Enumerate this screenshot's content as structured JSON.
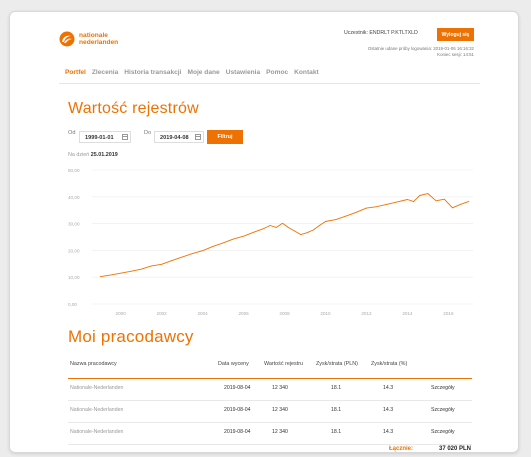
{
  "header": {
    "logo_line1": "nationale",
    "logo_line2": "nederlanden",
    "user_label": "Uczestnik: ENDRLT P.KTLTXLD",
    "logout_label": "Wyloguj się",
    "last_login": "Ostatnie udane próby logowania: 2019-01-06 16:16:32",
    "session": "Koniec sesji: 14:51"
  },
  "nav": {
    "items": [
      "Portfel",
      "Zlecenia",
      "Historia transakcji",
      "Moje dane",
      "Ustawienia",
      "Pomoc",
      "Kontakt"
    ],
    "active": "Portfel"
  },
  "registry": {
    "title": "Wartość rejestrów",
    "from_label": "Od",
    "from_value": "1999-01-01",
    "to_label": "Do",
    "to_value": "2019-04-08",
    "filter_label": "Filtruj",
    "asof_label": "Na dzień",
    "asof_value": "25.01.2019"
  },
  "chart_data": {
    "type": "line",
    "title": "",
    "xlabel": "",
    "ylabel": "",
    "xlim": [
      1998.6,
      2017.2
    ],
    "ylim": [
      0,
      50
    ],
    "y_ticks": [
      0,
      10,
      20,
      30,
      40,
      50
    ],
    "y_tick_labels": [
      "0,00",
      "10,00",
      "20,00",
      "30,00",
      "40,00",
      "50,00"
    ],
    "x_ticks": [
      2000,
      2002,
      2004,
      2006,
      2008,
      2010,
      2012,
      2014,
      2016
    ],
    "x_tick_labels": [
      "2000",
      "2002",
      "2004",
      "2006",
      "2008",
      "2010",
      "2012",
      "2014",
      "2016"
    ],
    "grid": true,
    "color": "#ee7203",
    "series": [
      {
        "x": [
          1999.0,
          1999.5,
          2000.0,
          2000.5,
          2001.0,
          2001.5,
          2002.0,
          2002.5,
          2003.0,
          2003.5,
          2004.0,
          2004.5,
          2005.0,
          2005.5,
          2006.0,
          2006.5,
          2007.0,
          2007.3,
          2007.6,
          2007.9,
          2008.2,
          2008.5,
          2008.8,
          2009.1,
          2009.4,
          2009.7,
          2010.0,
          2010.5,
          2011.0,
          2011.5,
          2012.0,
          2012.5,
          2013.0,
          2013.5,
          2014.0,
          2014.3,
          2014.6,
          2015.0,
          2015.4,
          2015.8,
          2016.2,
          2016.6,
          2017.0
        ],
        "values": [
          10.2,
          10.8,
          11.5,
          12.2,
          13.0,
          14.2,
          14.8,
          16.2,
          17.5,
          18.8,
          19.9,
          21.5,
          22.8,
          24.2,
          25.3,
          26.8,
          28.2,
          29.3,
          28.6,
          30.1,
          28.5,
          27.2,
          25.9,
          26.6,
          27.6,
          29.3,
          30.8,
          31.5,
          32.8,
          34.2,
          35.8,
          36.3,
          37.2,
          38.1,
          39.0,
          38.2,
          40.5,
          41.2,
          38.5,
          39.1,
          35.9,
          37.2,
          38.3
        ]
      }
    ]
  },
  "employers": {
    "title": "Moi pracodawcy",
    "columns": [
      "Nazwa pracodawcy",
      "Data wyceny",
      "Wartość rejestru",
      "Zysk/strata (PLN)",
      "Zysk/strata (%)"
    ],
    "rows": [
      {
        "name": "Nationale-Nederlanden",
        "date": "2019-08-04",
        "value": "12 340",
        "pln": "18.1",
        "pct": "14.3",
        "link": "Szczegóły"
      },
      {
        "name": "Nationale-Nederlanden",
        "date": "2019-08-04",
        "value": "12 340",
        "pln": "18.1",
        "pct": "14.3",
        "link": "Szczegóły"
      },
      {
        "name": "Nationale-Nederlanden",
        "date": "2019-08-04",
        "value": "12 340",
        "pln": "18.1",
        "pct": "14.3",
        "link": "Szczegóły"
      }
    ],
    "total_label": "Łącznie:",
    "total_value": "37 020 PLN"
  },
  "colors": {
    "accent": "#ee7203"
  }
}
